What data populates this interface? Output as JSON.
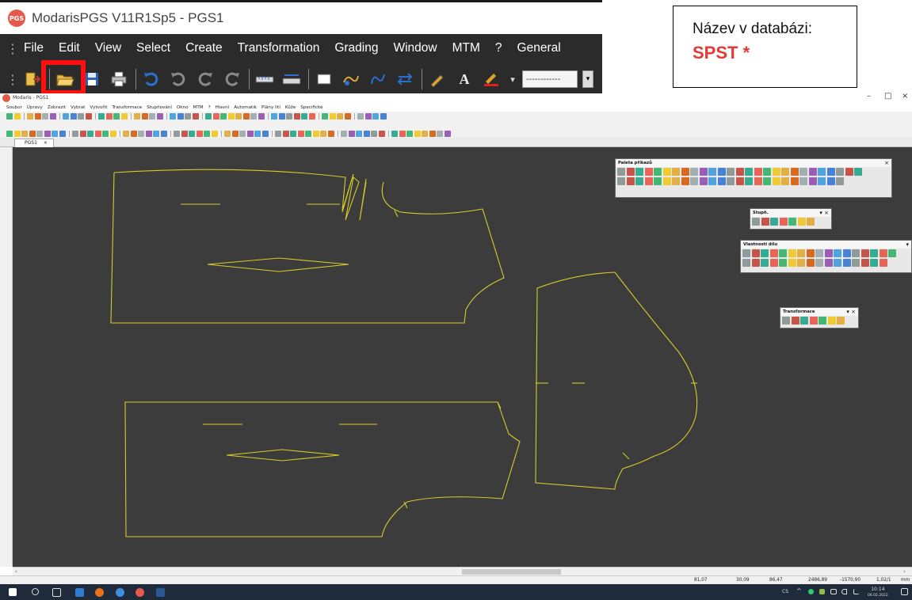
{
  "zoomed_inset": {
    "title": "ModarisPGS V11R1Sp5 - PGS1",
    "logo_text": "PGS",
    "menu": [
      "File",
      "Edit",
      "View",
      "Select",
      "Create",
      "Transformation",
      "Grading",
      "Window",
      "MTM",
      "?",
      "General"
    ],
    "line_style_value": "------------",
    "highlighted_tool": "open-file"
  },
  "callout": {
    "line1": "Název v databázi:",
    "line2": "SPST  *",
    "accent": "#e53935"
  },
  "window": {
    "title": "Modaris - PGS1",
    "controls": [
      "–",
      "□",
      "×"
    ],
    "menu": [
      "Soubor",
      "Úpravy",
      "Zobrazit",
      "Vybrat",
      "Vytvořit",
      "Transformace",
      "Stupňování",
      "Okno",
      "MTM",
      "?",
      "Hlavní",
      "Automatik",
      "Plány lití",
      "Kůže",
      "Specifické"
    ],
    "tab": "PGS1",
    "canvas_color": "#3c3c3c",
    "pattern_color": "#d6cc2a"
  },
  "palettes": {
    "paleta": {
      "title": "Paleta příkazů"
    },
    "stupn": {
      "title": "Stupň."
    },
    "vlastnosti": {
      "title": "Vlastnosti dílu"
    },
    "transformace": {
      "title": "Transformace"
    }
  },
  "status": {
    "values": [
      "81,07",
      "30,09",
      "86,47",
      "2486,89",
      "-1570,90",
      "1,02/1",
      "mm"
    ]
  },
  "taskbar": {
    "lang": "CS",
    "time": "10:14",
    "date": "06.02.2022"
  }
}
